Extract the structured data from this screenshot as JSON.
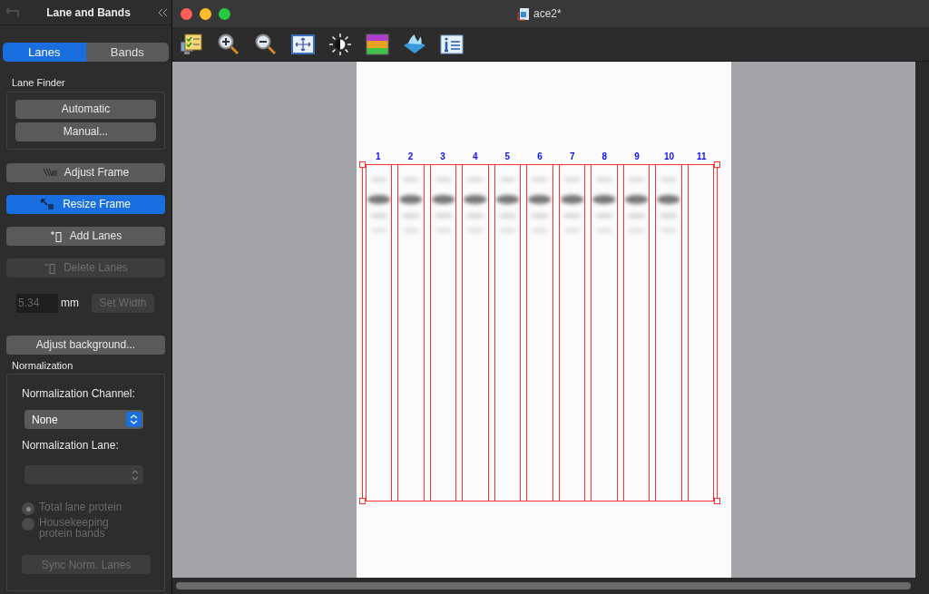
{
  "panel": {
    "title": "Lane and Bands",
    "tabs": [
      {
        "label": "Lanes",
        "selected": true
      },
      {
        "label": "Bands",
        "selected": false
      }
    ],
    "lane_finder": {
      "title": "Lane Finder",
      "buttons": [
        "Automatic",
        "Manual..."
      ]
    },
    "tools": [
      {
        "kind": "adjust",
        "label": "Adjust Frame",
        "selected": false,
        "disabled": false
      },
      {
        "kind": "resize",
        "label": "Resize Frame",
        "selected": true,
        "disabled": false
      },
      {
        "kind": "add",
        "label": "Add Lanes",
        "selected": false,
        "disabled": false
      },
      {
        "kind": "delete",
        "label": "Delete Lanes",
        "selected": false,
        "disabled": true
      }
    ],
    "width": {
      "value": "5.34",
      "unit": "mm",
      "button": "Set Width",
      "disabled": true
    },
    "adjust_background": "Adjust background...",
    "normalization": {
      "title": "Normalization",
      "channel_label": "Normalization Channel:",
      "channel_value": "None",
      "lane_label": "Normalization Lane:",
      "lane_disabled": true,
      "options": [
        {
          "label": "Total lane protein",
          "selected": true,
          "disabled": true
        },
        {
          "label": "Housekeeping protein bands",
          "selected": false,
          "disabled": true
        }
      ],
      "sync_button": "Sync Norm. Lanes",
      "sync_disabled": true
    }
  },
  "window": {
    "title": "ace2*"
  },
  "lanes": [
    {
      "label": "1"
    },
    {
      "label": "2"
    },
    {
      "label": "3"
    },
    {
      "label": "4"
    },
    {
      "label": "5"
    },
    {
      "label": "6"
    },
    {
      "label": "7"
    },
    {
      "label": "8"
    },
    {
      "label": "9"
    },
    {
      "label": "10"
    },
    {
      "label": "11"
    }
  ]
}
